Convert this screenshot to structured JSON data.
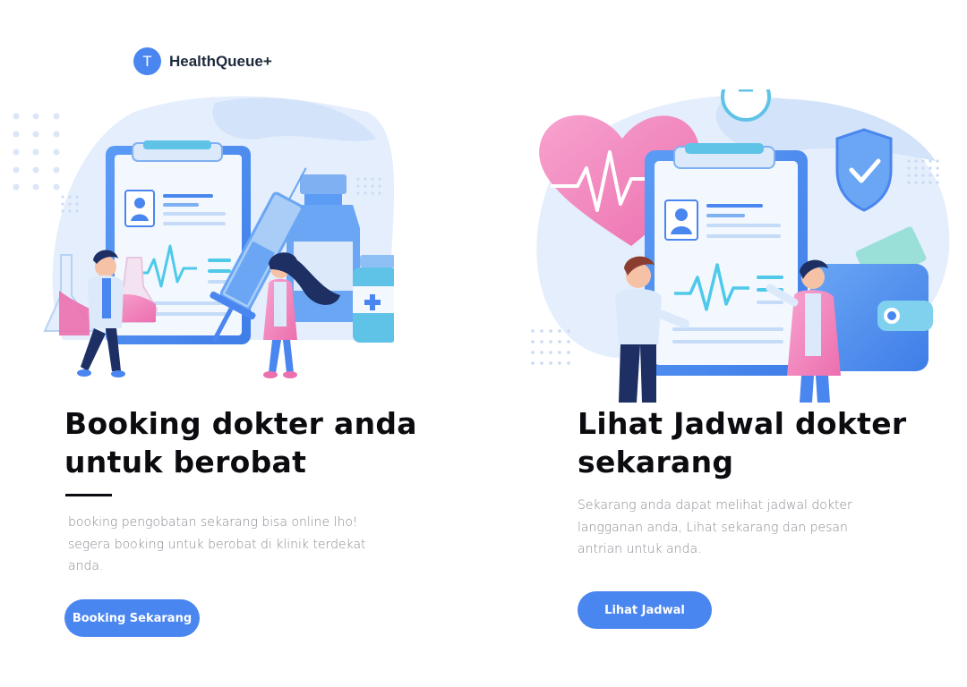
{
  "brand": {
    "logo_letter": "T",
    "name": "HealthQueue+"
  },
  "cards": [
    {
      "title": "Booking dokter anda untuk berobat",
      "description": "booking pengobatan sekarang bisa online lho! segera booking untuk berobat di klinik terdekat anda.",
      "button_label": "Booking Sekarang",
      "illustration": "doctors-clipboard-medicine-illustration"
    },
    {
      "title": "Lihat Jadwal dokter sekarang",
      "description": "Sekarang anda dapat melihat jadwal dokter langganan anda, Lihat sekarang dan pesan antrian untuk anda.",
      "button_label": "Lihat Jadwal",
      "illustration": "doctors-clipboard-heart-wallet-illustration"
    }
  ],
  "colors": {
    "accent": "#4a86f0",
    "heading": "#0b0b10",
    "body_text": "#8a8a94",
    "pink": "#f48cc0",
    "light_blue": "#dde9fb"
  }
}
